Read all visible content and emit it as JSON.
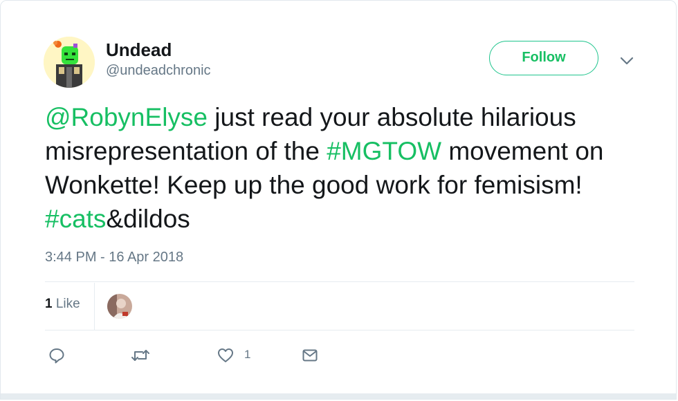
{
  "user": {
    "name": "Undead",
    "handle": "@undeadchronic"
  },
  "header": {
    "follow_label": "Follow"
  },
  "tweet": {
    "mention": "@RobynElyse",
    "text_part1": " just read your absolute hilarious misrepresentation of the ",
    "hashtag_mgtow": "#MGTOW",
    "text_part2": " movement on Wonkette! Keep up the good work for femisism! ",
    "hashtag_cats": "#cats",
    "text_part3": "&dildos"
  },
  "meta": {
    "timestamp": "3:44 PM - 16 Apr 2018"
  },
  "stats": {
    "likes_number": "1",
    "likes_label": " Like"
  },
  "actions": {
    "like_count": "1",
    "icons": [
      "reply-icon",
      "retweet-icon",
      "heart-icon",
      "message-icon"
    ]
  },
  "colors": {
    "accent": "#17bf63",
    "text": "#14171a",
    "secondary": "#657786",
    "divider": "#e6ecf0"
  }
}
